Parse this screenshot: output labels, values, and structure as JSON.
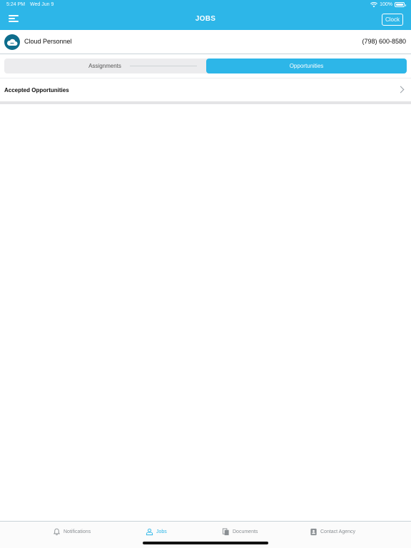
{
  "status_bar": {
    "time": "5:24 PM",
    "date": "Wed Jun 9",
    "battery": "100%"
  },
  "header": {
    "title": "JOBS",
    "clock_label": "Clock"
  },
  "agency": {
    "name": "Cloud Personnel",
    "phone": "(798) 600-8580"
  },
  "segments": {
    "assignments": "Assignments",
    "opportunities": "Opportunities",
    "selected": "Opportunities"
  },
  "list": {
    "accepted_label": "Accepted Opportunities"
  },
  "tabs": [
    {
      "label": "Notifications",
      "icon": "bell-icon"
    },
    {
      "label": "Jobs",
      "icon": "jobs-icon"
    },
    {
      "label": "Documents",
      "icon": "documents-icon"
    },
    {
      "label": "Contact Agency",
      "icon": "contact-card-icon"
    }
  ],
  "colors": {
    "accent": "#2db6e8",
    "logo_bg": "#0e6d8c",
    "inactive_tab": "#8a8f93"
  }
}
